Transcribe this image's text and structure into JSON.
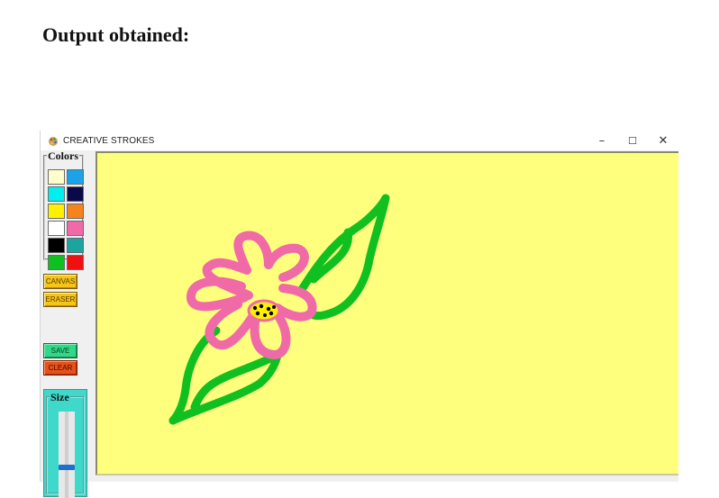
{
  "heading": "Output obtained:",
  "window": {
    "title": "CREATIVE STROKES",
    "icon": "palette-icon",
    "controls": {
      "minimize": "–",
      "maximize": "☐",
      "close": "✕"
    }
  },
  "colors_panel": {
    "label": "Colors",
    "swatches": [
      {
        "name": "cream",
        "hex": "#ffffcc"
      },
      {
        "name": "sky-blue",
        "hex": "#1aa3e8"
      },
      {
        "name": "cyan",
        "hex": "#00f0f0"
      },
      {
        "name": "navy",
        "hex": "#0a0a4a"
      },
      {
        "name": "yellow",
        "hex": "#fff000"
      },
      {
        "name": "orange",
        "hex": "#f5841f"
      },
      {
        "name": "white",
        "hex": "#ffffff"
      },
      {
        "name": "pink",
        "hex": "#f06aa8"
      },
      {
        "name": "black",
        "hex": "#000000"
      },
      {
        "name": "teal",
        "hex": "#1aa5a0"
      },
      {
        "name": "green",
        "hex": "#10c020"
      },
      {
        "name": "red",
        "hex": "#f01010"
      }
    ]
  },
  "buttons": {
    "canvas": "CANVAS",
    "eraser": "ERASER",
    "save": "SAVE",
    "clear": "CLEAR"
  },
  "size_panel": {
    "label": "Size",
    "value_fraction": 0.66
  },
  "canvas": {
    "background": "#ffff7e",
    "stroke_colors": {
      "stem": "#10c020",
      "petals": "#f06aa8",
      "center": "#fff000",
      "dots": "#000000"
    }
  }
}
